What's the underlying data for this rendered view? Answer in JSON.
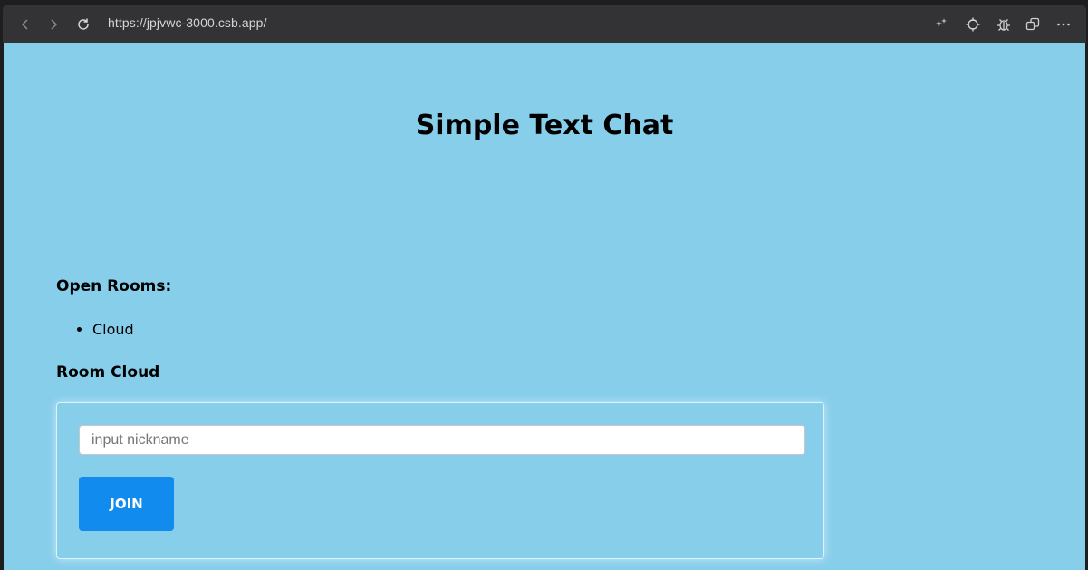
{
  "browser": {
    "url": "https://jpjvwc-3000.csb.app/",
    "icons": {
      "back": "back-arrow-icon",
      "forward": "forward-arrow-icon",
      "refresh": "refresh-icon",
      "sparkle": "sparkle-icon",
      "target": "crosshair-icon",
      "debug": "bug-icon",
      "windows": "windows-icon",
      "more": "more-icon"
    }
  },
  "page": {
    "title": "Simple Text Chat",
    "open_rooms_heading": "Open Rooms:",
    "rooms": [
      "Cloud"
    ],
    "room_heading": "Room Cloud",
    "nickname_placeholder": "input nickname",
    "nickname_value": "",
    "join_label": "JOIN"
  },
  "colors": {
    "page_background": "#87ceeb",
    "button_background": "#118bee",
    "toolbar_background": "#333335"
  }
}
